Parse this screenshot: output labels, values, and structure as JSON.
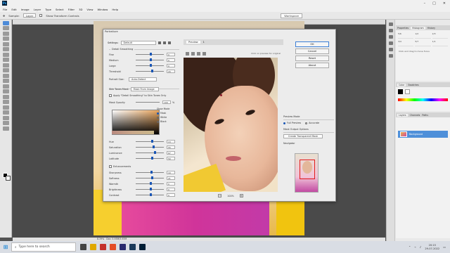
{
  "app": {
    "menu": [
      "File",
      "Edit",
      "Image",
      "Layer",
      "Type",
      "Select",
      "Filter",
      "3D",
      "View",
      "Window",
      "Help"
    ],
    "options": {
      "mode_label": "Sample:",
      "mode_value": "Layer",
      "transform_label": "Show Transform Controls",
      "workspace": "Workspace"
    }
  },
  "dialog": {
    "title": "Portraiture",
    "settings_label": "Settings:",
    "settings_value": "Default",
    "detail_smoothing": {
      "legend": "Detail Smoothing",
      "sliders": [
        {
          "label": "Fine",
          "value": "0",
          "level": 0.5
        },
        {
          "label": "Medium",
          "value": "0",
          "level": 0.5
        },
        {
          "label": "Large",
          "value": "0",
          "level": 0.5
        },
        {
          "label": "Threshold",
          "value": "20",
          "level": 0.55
        }
      ],
      "portrait_size_label": "Portrait Size:",
      "portrait_size_value": "Auto-Detect"
    },
    "skin_tones": {
      "legend": "Skin Tones Mask",
      "mode_value": "Mask From Image",
      "apply_label": "Apply \"Detail Smoothing\" to Skin Tones Only",
      "opacity_label": "Mask Opacity",
      "opacity_value": "100",
      "show_mode_label": "Show Mode",
      "show_modes": [
        "Mask",
        "White",
        "Black"
      ],
      "sliders": [
        {
          "label": "Hue",
          "value": "13",
          "level": 0.55
        },
        {
          "label": "Saturation",
          "value": "55",
          "level": 0.6
        },
        {
          "label": "Luminance",
          "value": "67",
          "level": 0.65
        },
        {
          "label": "Latitude",
          "value": "50",
          "level": 0.55
        }
      ]
    },
    "enhancements": {
      "legend": "Enhancements",
      "sliders": [
        {
          "label": "Sharpness",
          "value": "10",
          "level": 0.52
        },
        {
          "label": "Softness",
          "value": "21",
          "level": 0.55
        },
        {
          "label": "Warmth",
          "value": "0",
          "level": 0.5
        },
        {
          "label": "Brightness",
          "value": "0",
          "level": 0.5
        },
        {
          "label": "Contrast",
          "value": "0",
          "level": 0.5
        }
      ]
    },
    "preview": {
      "tabs": [
        "Preview",
        "1"
      ],
      "hint": "Click on preview for original",
      "zoom": "100%"
    },
    "buttons": {
      "ok": "OK",
      "cancel": "Cancel",
      "reset": "Reset",
      "about": "About"
    },
    "preview_mode": {
      "legend": "Preview Mode",
      "options": [
        "Full Preview",
        "Accurate"
      ]
    },
    "mask_output": {
      "legend": "Mask Output Options",
      "button": "Create Transparent Mask"
    },
    "navigator_label": "Navigator"
  },
  "panels": {
    "history_tabs": [
      "Properties",
      "Histogram",
      "History"
    ],
    "history_items": [
      "5/6",
      "1/2",
      "2/3",
      "3/4",
      "5/7",
      "1/1"
    ],
    "history_note": "Click and drag to move focus",
    "color_tabs": [
      "Color",
      "Swatches"
    ],
    "layer_tabs": [
      "Layers",
      "Channels",
      "Paths"
    ],
    "layer_name": "Background"
  },
  "status": {
    "zoom": "8.39%",
    "doc": "Doc: 5.93M/5.93M"
  },
  "taskbar": {
    "search_placeholder": "Type here to search",
    "time": "20:15",
    "date": "29-07-2022"
  }
}
